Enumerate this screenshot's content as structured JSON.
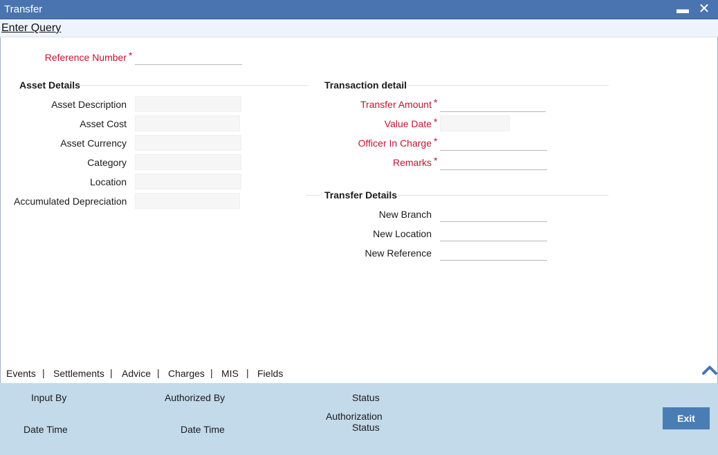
{
  "window": {
    "title": "Transfer",
    "minimize_glyph": "▬",
    "close_glyph": "✕"
  },
  "menu": {
    "enter_query": "Enter Query"
  },
  "reference_number": {
    "label": "Reference Number",
    "value": ""
  },
  "asset_details": {
    "heading": "Asset Details",
    "fields": [
      {
        "label": "Asset Description",
        "value": ""
      },
      {
        "label": "Asset Cost",
        "value": ""
      },
      {
        "label": "Asset Currency",
        "value": ""
      },
      {
        "label": "Category",
        "value": ""
      },
      {
        "label": "Location",
        "value": ""
      },
      {
        "label": "Accumulated Depreciation",
        "value": ""
      }
    ]
  },
  "transaction_detail": {
    "heading": "Transaction detail",
    "fields": [
      {
        "label": "Transfer Amount",
        "value": ""
      },
      {
        "label": "Value Date",
        "value": ""
      },
      {
        "label": "Officer In Charge",
        "value": ""
      },
      {
        "label": "Remarks",
        "value": ""
      }
    ]
  },
  "transfer_details": {
    "heading": "Transfer Details",
    "fields": [
      {
        "label": "New Branch",
        "value": ""
      },
      {
        "label": "New Location",
        "value": ""
      },
      {
        "label": "New Reference",
        "value": ""
      }
    ]
  },
  "required_marker": "*",
  "tabs": [
    "Events",
    "Settlements",
    "Advice",
    "Charges",
    "MIS",
    "Fields"
  ],
  "tab_separator": "|",
  "collapse_icon": "chevron-up-icon",
  "footer": {
    "input_by": "Input By",
    "date_time_1": "Date Time",
    "authorized_by": "Authorized By",
    "date_time_2": "Date Time",
    "status": "Status",
    "authorization_status_line1": "Authorization",
    "authorization_status_line2": "Status",
    "exit_label": "Exit"
  },
  "colors": {
    "titlebar": "#4a74b0",
    "required": "#c8102e",
    "footer": "#c3daea",
    "exit_button": "#4a7db3"
  }
}
